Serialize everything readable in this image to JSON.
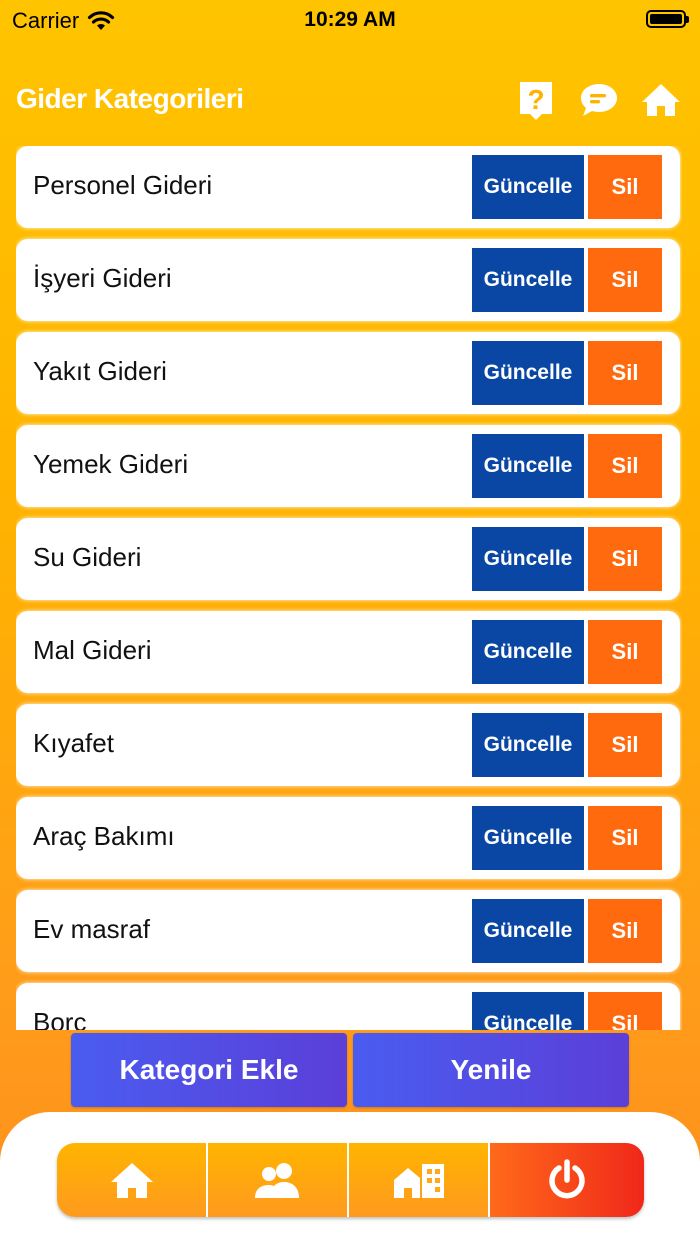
{
  "status_bar": {
    "carrier": "Carrier",
    "time": "10:29 AM"
  },
  "header": {
    "title": "Gider Kategorileri",
    "icons": [
      "help-icon",
      "chat-icon",
      "home-icon"
    ]
  },
  "categories": [
    {
      "name": "Personel Gideri",
      "update_label": "Güncelle",
      "delete_label": "Sil"
    },
    {
      "name": "İşyeri Gideri",
      "update_label": "Güncelle",
      "delete_label": "Sil"
    },
    {
      "name": "Yakıt Gideri",
      "update_label": "Güncelle",
      "delete_label": "Sil"
    },
    {
      "name": "Yemek Gideri",
      "update_label": "Güncelle",
      "delete_label": "Sil"
    },
    {
      "name": "Su Gideri",
      "update_label": "Güncelle",
      "delete_label": "Sil"
    },
    {
      "name": "Mal Gideri",
      "update_label": "Güncelle",
      "delete_label": "Sil"
    },
    {
      "name": "Kıyafet",
      "update_label": "Güncelle",
      "delete_label": "Sil"
    },
    {
      "name": "Araç Bakımı",
      "update_label": "Güncelle",
      "delete_label": "Sil"
    },
    {
      "name": "Ev masraf",
      "update_label": "Güncelle",
      "delete_label": "Sil"
    },
    {
      "name": "Borç",
      "update_label": "Güncelle",
      "delete_label": "Sil"
    }
  ],
  "actions": {
    "add_label": "Kategori Ekle",
    "refresh_label": "Yenile"
  },
  "tabbar": {
    "icons": [
      "home-icon",
      "users-icon",
      "buildings-icon",
      "power-icon"
    ]
  },
  "colors": {
    "update_button": "#0a46a3",
    "delete_button": "#ff6a0e",
    "action_button": "#4a5cf0",
    "background": "#ffc400"
  }
}
